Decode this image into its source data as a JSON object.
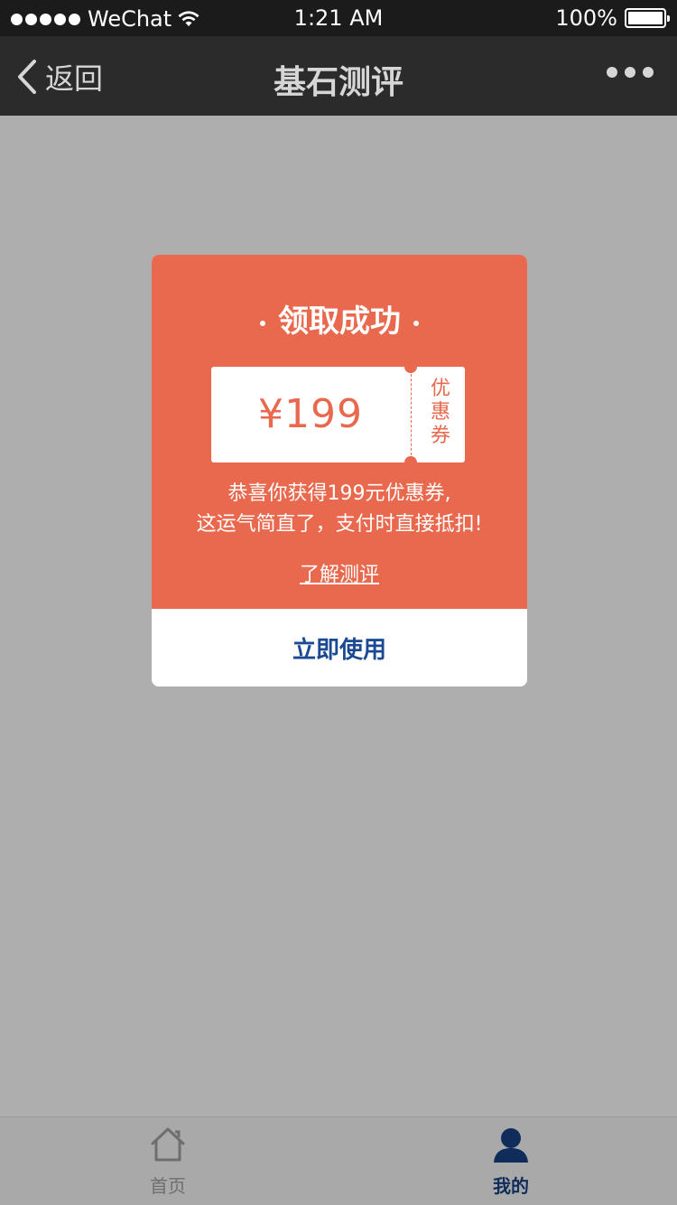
{
  "status_bar": {
    "carrier": "WeChat",
    "time": "1:21 AM",
    "battery": "100%"
  },
  "nav": {
    "back_label": "返回",
    "title": "基石测评"
  },
  "modal": {
    "title": "领取成功",
    "coupon_amount": "¥199",
    "coupon_tag": [
      "优",
      "惠",
      "券"
    ],
    "message_line1": "恭喜你获得199元优惠券,",
    "message_line2": "这运气简直了，支付时直接抵扣!",
    "learn_link": "了解测评",
    "use_button": "立即使用"
  },
  "tabs": [
    {
      "label": "首页",
      "icon": "home-icon",
      "active": false
    },
    {
      "label": "我的",
      "icon": "user-icon",
      "active": true
    }
  ],
  "colors": {
    "accent": "#e8694e",
    "button_text": "#1b4a92",
    "overlay": "#aeaeae",
    "nav_bg": "#2b2b2b"
  }
}
